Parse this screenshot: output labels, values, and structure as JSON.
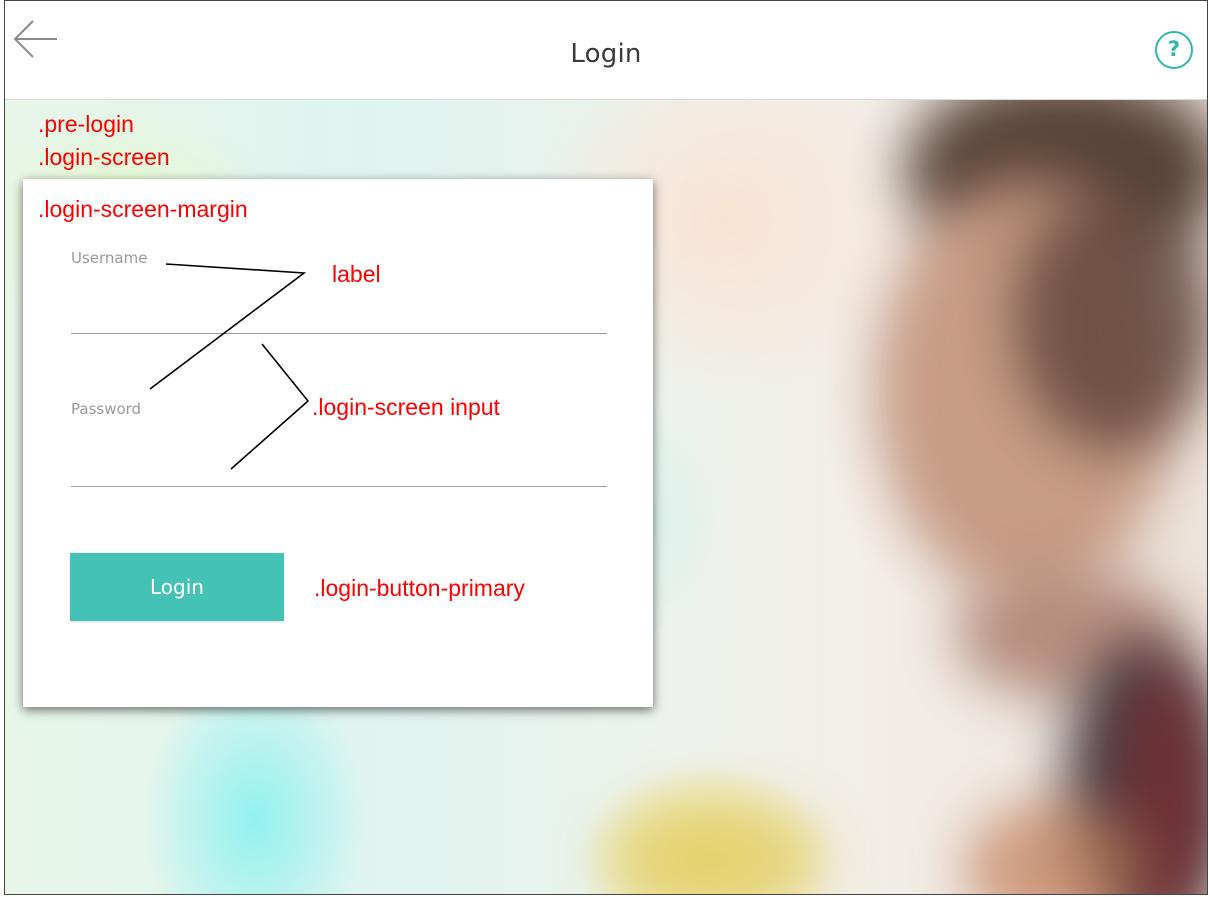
{
  "header": {
    "title": "Login",
    "help_symbol": "?",
    "back_icon": "arrow-left-icon"
  },
  "form": {
    "username_label": "Username",
    "password_label": "Password",
    "username_value": "",
    "password_value": "",
    "login_button_label": "Login"
  },
  "annotations": {
    "pre_login": ".pre-login",
    "login_screen": ".login-screen",
    "login_screen_margin": ".login-screen-margin",
    "label": "label",
    "login_screen_input": ".login-screen input",
    "login_button_primary": ".login-button-primary"
  },
  "colors": {
    "accent": "#45c2b6",
    "annotation": "#ff0000"
  }
}
